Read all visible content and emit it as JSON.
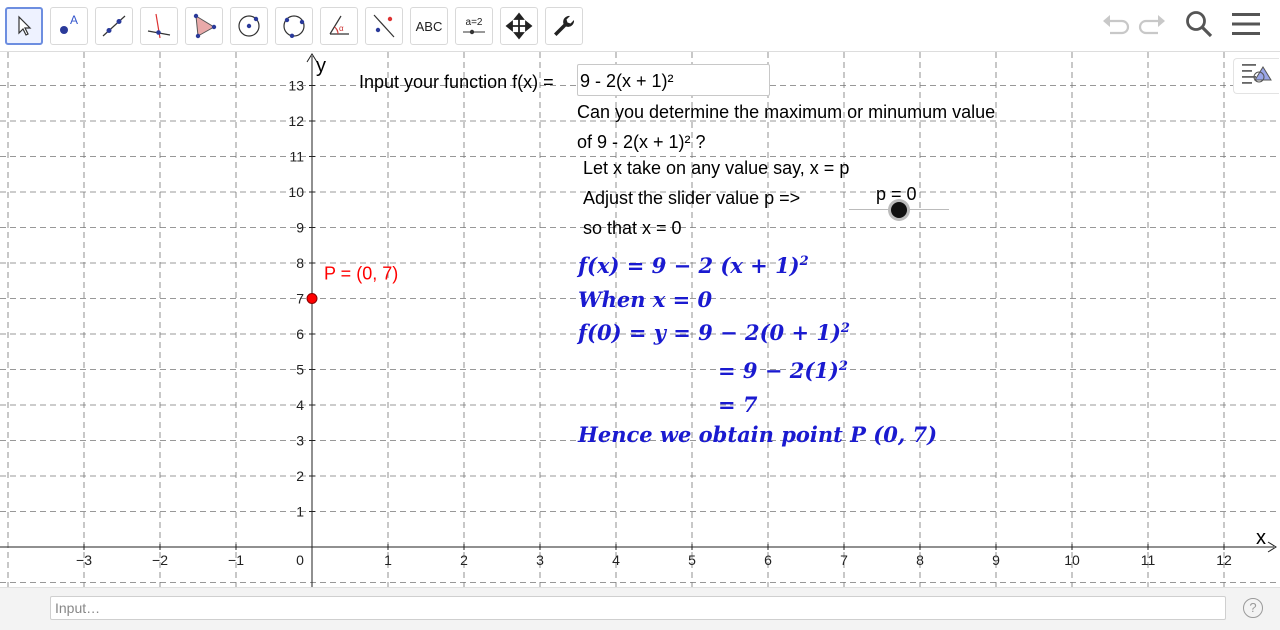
{
  "toolbar": {
    "tools": [
      {
        "name": "move",
        "icon": "pointer-arrow-icon"
      },
      {
        "name": "point",
        "icon": "point-icon"
      },
      {
        "name": "line",
        "icon": "line-through-points-icon"
      },
      {
        "name": "perpendicular",
        "icon": "perpendicular-line-icon"
      },
      {
        "name": "polygon",
        "icon": "polygon-icon"
      },
      {
        "name": "circle-center",
        "icon": "circle-center-point-icon"
      },
      {
        "name": "circle-three-points",
        "icon": "circle-three-points-icon"
      },
      {
        "name": "angle",
        "icon": "angle-icon"
      },
      {
        "name": "reflect",
        "icon": "reflect-line-icon"
      },
      {
        "name": "text",
        "label": "ABC"
      },
      {
        "name": "slider",
        "label": "a=2"
      },
      {
        "name": "move-graphics",
        "icon": "move-graphics-icon"
      },
      {
        "name": "tools",
        "icon": "wrench-icon"
      }
    ],
    "right_icons": [
      "undo-icon",
      "redo-icon",
      "search-icon",
      "menu-icon"
    ]
  },
  "graph": {
    "x_axis_label": "x",
    "y_axis_label": "y",
    "x_ticks": [
      "−3",
      "−2",
      "−1",
      "0",
      "1",
      "2",
      "3",
      "4",
      "5",
      "6",
      "7",
      "8",
      "9",
      "10",
      "11",
      "12"
    ],
    "y_ticks": [
      "1",
      "2",
      "3",
      "4",
      "5",
      "6",
      "7",
      "8",
      "9",
      "10",
      "11",
      "12",
      "13"
    ],
    "x_range": [
      -4,
      12.5
    ],
    "y_range": [
      -1,
      14
    ],
    "grid": true,
    "point": {
      "label": "P = (0, 7)",
      "x": 0,
      "y": 7,
      "color": "#ff0000"
    }
  },
  "input_label": "Input your function f(x) =",
  "function_value": "9 - 2(x + 1)²",
  "question_line1": "Can you determine the maximum or minumum value",
  "question_line2": "of 9 - 2(x + 1)² ?",
  "let_text": "Let x take on any value say, x = p",
  "adjust_text": "Adjust the slider value p =>",
  "so_that_text": "so that x = 0",
  "slider": {
    "label": "p = 0",
    "value": 0
  },
  "math": {
    "line1": "f(x) = 9 − 2 (x + 1)",
    "line1_exp": "2",
    "line2": "When x = 0",
    "line3": "f(0) = y = 9 − 2(0 + 1)",
    "line3_exp": "2",
    "line4": "= 9 − 2(1)",
    "line4_exp": "2",
    "line5": "= 7",
    "line6": "Hence we obtain point P (0, 7)",
    "color": "#1a1ad0"
  },
  "input_bar": {
    "placeholder": "Input…",
    "help_label": "?"
  }
}
